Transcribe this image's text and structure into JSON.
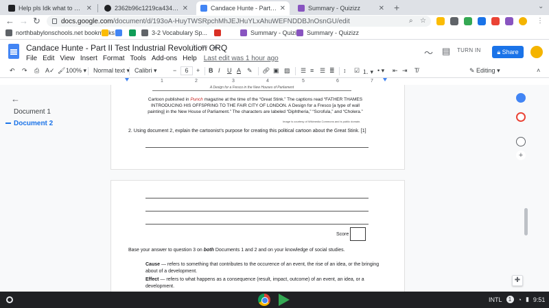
{
  "browser": {
    "tabs": [
      {
        "title": "Help pls Idk what to do - Brainly",
        "favicon_color": "#202124",
        "active": false
      },
      {
        "title": "2362b96c1219ca434abe6491",
        "favicon_color": "#202124",
        "active": false
      },
      {
        "title": "Candace Hunte - Part II Test Indu",
        "favicon_color": "#4285f4",
        "active": true
      },
      {
        "title": "Summary - Quizizz",
        "favicon_color": "#8854c0",
        "active": false
      }
    ],
    "new_tab_symbol": "+",
    "url_domain": "docs.google.com",
    "url_path": "/document/d/193oA-HuyTWSRpchMhJEJHuYLxAhuWEFNDDBJnOsnGU/edit",
    "bookmarks": [
      {
        "label": "northbabylonschools.net bookmarks",
        "color": "#5f6368"
      },
      {
        "label": "",
        "color": "#fbbc04"
      },
      {
        "label": "",
        "color": "#4285f4"
      },
      {
        "label": "",
        "color": "#0f9d58"
      },
      {
        "label": "3-2 Vocabulary Sp...",
        "color": "#5f6368"
      },
      {
        "label": "",
        "color": "#d93025"
      },
      {
        "label": "Summary - Quizizz",
        "color": "#8854c0"
      },
      {
        "label": "Summary - Quizizz",
        "color": "#8854c0"
      }
    ]
  },
  "docs": {
    "title": "Candace Hunte - Part II Test Industrial Revolution CRQ",
    "menu": [
      "File",
      "Edit",
      "View",
      "Insert",
      "Format",
      "Tools",
      "Add-ons",
      "Help"
    ],
    "last_edit": "Last edit was 1 hour ago",
    "turn_in": "TURN IN",
    "share": "Share"
  },
  "toolbar": {
    "zoom": "100%",
    "style": "Normal text",
    "font": "Calibri",
    "font_size": "6",
    "mode": "Editing"
  },
  "ruler": [
    "1",
    "2",
    "3",
    "4",
    "5",
    "6",
    "7"
  ],
  "outline": {
    "items": [
      "Document 1",
      "Document 2"
    ]
  },
  "page1": {
    "image_caption": "A Design for a Fresco in the New Houses of Parliament",
    "caption_pre": "Cartoon published in ",
    "caption_em": "Punch",
    "caption_post": " magazine at the time of the “Great Stink.” The captions read “FATHER THAMES INTRODUCING HIS OFFSPRING TO THE FAIR CITY OF LONDON. A Design for a Fresco [a type of wall painting] in the New House of Parliament.” The characters are labeled “Diphtheria,” “Scrofula,” and “Cholera.”",
    "credit": "Image is courtesy of Wikimedia Commons and is public domain.",
    "question": "2. Using document 2, explain the cartoonist’s purpose for creating this political cartoon about the Great Stink. [1]"
  },
  "page2": {
    "score_label": "Score",
    "base_text_pre": "Base your answer to question 3 on ",
    "base_text_em": "both",
    "base_text_post": " Documents 1 and 2 and on your knowledge of social studies.",
    "cause_term": "Cause",
    "cause_def": " — refers to something that contributes to the occurence of an event, the rise of an idea, or the bringing about of a development.",
    "effect_term": "Effect",
    "effect_def": " — refers to what happens as a consequence (result, impact, outcome) of an event, an idea, or a development."
  },
  "shelf": {
    "locale": "INTL",
    "notifications": "1",
    "time": "9:51"
  }
}
